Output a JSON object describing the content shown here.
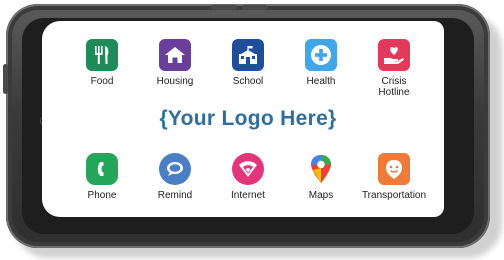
{
  "logo_text": "{Your Logo Here}",
  "colors": {
    "logo": "#2f6e9e",
    "food": "#1f8a5a",
    "housing": "#6a3f9c",
    "school": "#1f4f9a",
    "health": "#3fa6e8",
    "crisis": "#e33a5b",
    "phone": "#25a65a",
    "remind": "#4a7fc6",
    "internet": "#e2357c",
    "transport": "#f07a3a"
  },
  "apps_top": [
    {
      "label": "Food",
      "icon": "fork-knife-icon"
    },
    {
      "label": "Housing",
      "icon": "house-icon"
    },
    {
      "label": "School",
      "icon": "school-building-icon"
    },
    {
      "label": "Health",
      "icon": "plus-circle-icon"
    },
    {
      "label": "Crisis\nHotline",
      "icon": "heart-hand-icon"
    }
  ],
  "apps_bottom": [
    {
      "label": "Phone",
      "icon": "phone-icon"
    },
    {
      "label": "Remind",
      "icon": "chat-bubble-icon"
    },
    {
      "label": "Internet",
      "icon": "wifi-icon"
    },
    {
      "label": "Maps",
      "icon": "map-pin-icon"
    },
    {
      "label": "Transportation",
      "icon": "smiley-icon"
    }
  ]
}
